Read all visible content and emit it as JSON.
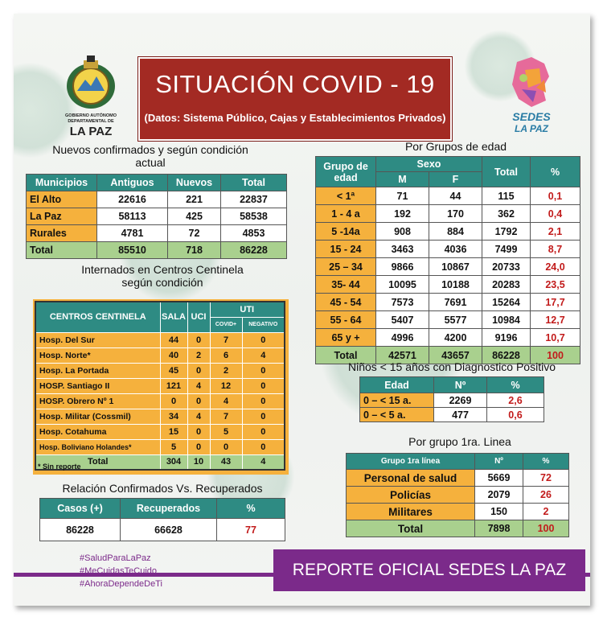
{
  "header": {
    "title": "SITUACIÓN  COVID - 19",
    "subtitle": "(Datos: Sistema Público, Cajas y Establecimientos Privados)"
  },
  "logo_left": {
    "line1": "GOBIERNO AUTÓNOMO",
    "line2": "DEPARTAMENTAL DE",
    "line3": "LA PAZ"
  },
  "logo_right": {
    "line1": "SEDES",
    "line2": "LA PAZ"
  },
  "confirmados": {
    "title": "Nuevos confirmados y según condición actual",
    "headers": [
      "Municipios",
      "Antiguos",
      "Nuevos",
      "Total"
    ],
    "rows": [
      [
        "El Alto",
        "22616",
        "221",
        "22837"
      ],
      [
        "La Paz",
        "58113",
        "425",
        "58538"
      ],
      [
        "Rurales",
        "4781",
        "72",
        "4853"
      ]
    ],
    "total": [
      "Total",
      "85510",
      "718",
      "86228"
    ]
  },
  "internados": {
    "title": "Internados en Centros Centinela según condición",
    "headers": {
      "centros": "CENTROS CENTINELA",
      "sala": "SALA",
      "uci": "UCI",
      "uti": "UTI",
      "covid": "COVID+",
      "negativo": "NEGATIVO"
    },
    "rows": [
      [
        "Hosp. Del Sur",
        "44",
        "0",
        "7",
        "0"
      ],
      [
        "Hosp. Norte*",
        "40",
        "2",
        "6",
        "4"
      ],
      [
        "Hosp. La Portada",
        "45",
        "0",
        "2",
        "0"
      ],
      [
        "HOSP. Santiago II",
        "121",
        "4",
        "12",
        "0"
      ],
      [
        "HOSP. Obrero Nº 1",
        "0",
        "0",
        "4",
        "0"
      ],
      [
        "Hosp. Militar (Cossmil)",
        "34",
        "4",
        "7",
        "0"
      ],
      [
        "Hosp. Cotahuma",
        "15",
        "0",
        "5",
        "0"
      ],
      [
        "Hosp. Boliviano Holandes*",
        "5",
        "0",
        "0",
        "0"
      ]
    ],
    "total": [
      "Total",
      "304",
      "10",
      "43",
      "4"
    ],
    "note": "* Sin reporte"
  },
  "relacion": {
    "title": "Relación Confirmados Vs. Recuperados",
    "headers": [
      "Casos (+)",
      "Recuperados",
      "%"
    ],
    "values": [
      "86228",
      "66628",
      "77"
    ]
  },
  "edad": {
    "title": "Por Grupos de  edad",
    "headers": {
      "grupo": "Grupo de edad",
      "sexo": "Sexo",
      "m": "M",
      "f": "F",
      "total": "Total",
      "pct": "%"
    },
    "rows": [
      [
        "< 1ª",
        "71",
        "44",
        "115",
        "0,1"
      ],
      [
        "1 - 4 a",
        "192",
        "170",
        "362",
        "0,4"
      ],
      [
        "5 -14a",
        "908",
        "884",
        "1792",
        "2,1"
      ],
      [
        "15 - 24",
        "3463",
        "4036",
        "7499",
        "8,7"
      ],
      [
        "25 – 34",
        "9866",
        "10867",
        "20733",
        "24,0"
      ],
      [
        "35- 44",
        "10095",
        "10188",
        "20283",
        "23,5"
      ],
      [
        "45 - 54",
        "7573",
        "7691",
        "15264",
        "17,7"
      ],
      [
        "55 - 64",
        "5407",
        "5577",
        "10984",
        "12,7"
      ],
      [
        "65 y +",
        "4996",
        "4200",
        "9196",
        "10,7"
      ]
    ],
    "total": [
      "Total",
      "42571",
      "43657",
      "86228",
      "100"
    ]
  },
  "ninos": {
    "title": "Niños < 15 años con Diagnostico Positivo",
    "headers": [
      "Edad",
      "Nº",
      "%"
    ],
    "rows": [
      [
        "0 – < 15 a.",
        "2269",
        "2,6"
      ],
      [
        "0 – < 5 a.",
        "477",
        "0,6"
      ]
    ]
  },
  "primera_linea": {
    "title": "Por grupo 1ra. Linea",
    "headers": [
      "Grupo 1ra línea",
      "Nº",
      "%"
    ],
    "rows": [
      [
        "Personal de salud",
        "5669",
        "72"
      ],
      [
        "Policías",
        "2079",
        "26"
      ],
      [
        "Militares",
        "150",
        "2"
      ]
    ],
    "total": [
      "Total",
      "7898",
      "100"
    ]
  },
  "hashtags": [
    "#SaludParaLaPaz",
    "#MeCuidasTeCuido",
    "#AhoraDependeDeTi"
  ],
  "footer": "REPORTE OFICIAL SEDES LA PAZ"
}
